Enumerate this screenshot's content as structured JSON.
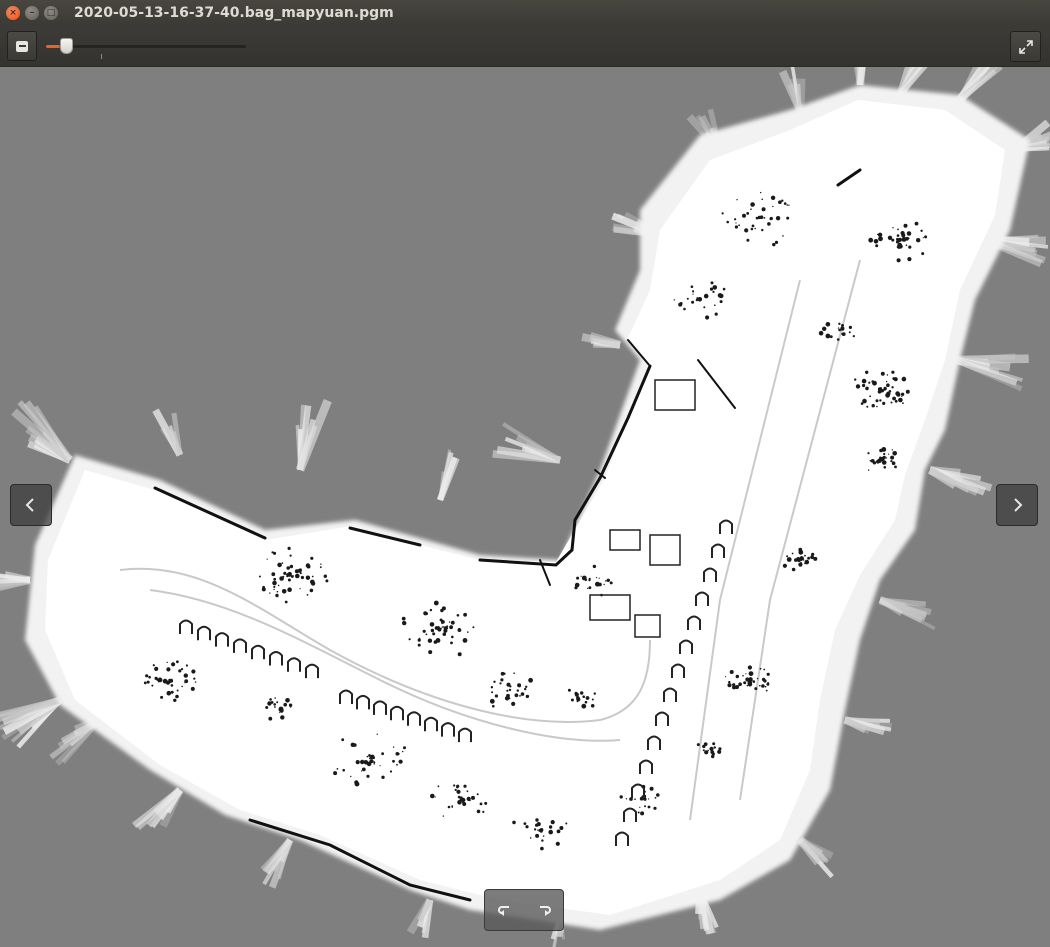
{
  "window": {
    "title": "2020-05-13-16-37-40.bag_mapyuan.pgm",
    "buttons": {
      "close": "×",
      "minimize": "–",
      "maximize": "□"
    }
  },
  "toolbar": {
    "zoom_out_icon": "zoom-out-icon",
    "zoom_level_fraction": 0.07,
    "fullscreen_icon": "fullscreen-icon"
  },
  "viewer": {
    "image": "occupancy-grid-map",
    "prev_icon": "chevron-left-icon",
    "next_icon": "chevron-right-icon",
    "rotate_left_icon": "rotate-ccw-icon",
    "rotate_right_icon": "rotate-cw-icon"
  },
  "colors": {
    "background": "#7f7f7f",
    "free_space": "#ffffff",
    "obstacle": "#000000",
    "accent": "#e5642a"
  }
}
